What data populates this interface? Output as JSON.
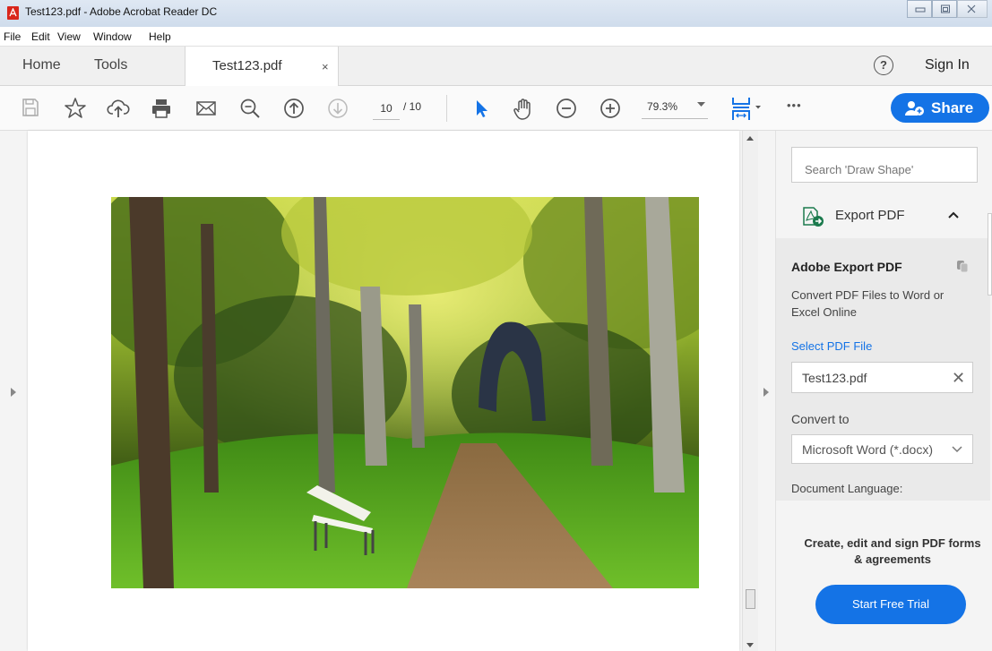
{
  "window": {
    "title": "Test123.pdf - Adobe Acrobat Reader DC"
  },
  "menu": [
    "File",
    "Edit",
    "View",
    "Window",
    "Help"
  ],
  "tabs": {
    "home": "Home",
    "tools": "Tools",
    "document": "Test123.pdf",
    "close": "×",
    "help": "?",
    "sign_in": "Sign In"
  },
  "toolbar": {
    "page_current": "10",
    "page_total": "/ 10",
    "zoom": "79.3%",
    "share_label": "Share",
    "more": "•••"
  },
  "right_panel": {
    "search_placeholder": "Search 'Draw Shape'",
    "export_header": "Export PDF",
    "export_title": "Adobe Export PDF",
    "export_desc": "Convert PDF Files to Word or Excel Online",
    "select_file_link": "Select PDF File",
    "selected_file": "Test123.pdf",
    "clear": "✕",
    "convert_to_label": "Convert to",
    "convert_to_value": "Microsoft Word (*.docx)",
    "document_language_label": "Document Language:",
    "promo_text": "Create, edit and sign PDF forms & agreements",
    "trial_button": "Start Free Trial"
  },
  "colors": {
    "accent": "#1473e6",
    "acrobat_red": "#d9261c"
  }
}
